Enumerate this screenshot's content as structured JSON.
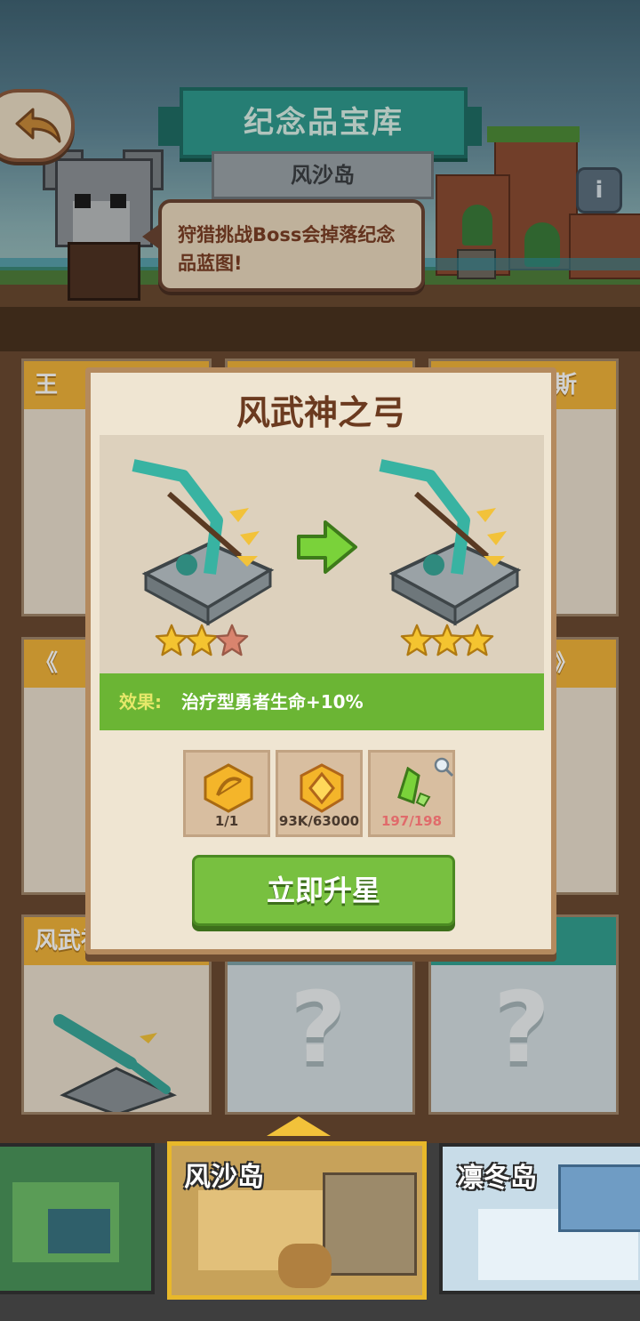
{
  "header": {
    "title": "纪念品宝库",
    "island_name": "风沙岛",
    "tip": "狩猎挑战Boss会掉落纪念品蓝图!",
    "info_label": "i"
  },
  "cards": [
    {
      "header": "王",
      "style": "gold"
    },
    {
      "header": "",
      "style": "gold"
    },
    {
      "header": "斯",
      "style": "gold"
    },
    {
      "header": "《",
      "style": "gold"
    },
    {
      "header": "",
      "style": "gold"
    },
    {
      "header": "》",
      "style": "gold"
    },
    {
      "header": "风武神之弓",
      "style": "gold"
    },
    {
      "header": "?",
      "style": "gray"
    },
    {
      "header": "?",
      "style": "teal"
    }
  ],
  "modal": {
    "title": "风武神之弓",
    "current_stars": 2,
    "next_stars": 3,
    "max_stars": 3,
    "effect_label": "效果:",
    "effect_text": "治疗型勇者生命+10%",
    "costs": [
      {
        "icon": "bow-blueprint-coin-icon",
        "text": "1/1",
        "sufficient": true
      },
      {
        "icon": "gold-coin-icon",
        "text": "93K/63000",
        "sufficient": true
      },
      {
        "icon": "green-crystal-icon",
        "text": "197/198",
        "sufficient": false
      }
    ],
    "upgrade_button": "立即升星"
  },
  "islands": [
    {
      "name": "",
      "color": "#3d7a4a"
    },
    {
      "name": "风沙岛",
      "color": "#c7a25a",
      "selected": true
    },
    {
      "name": "凛冬岛",
      "color": "#c8dce8"
    }
  ],
  "colors": {
    "accent_teal": "#2f9a8e",
    "button_green": "#78c040",
    "star_gold": "#f4c430",
    "star_empty": "#d9846e",
    "warning_red": "#e06b6b"
  }
}
